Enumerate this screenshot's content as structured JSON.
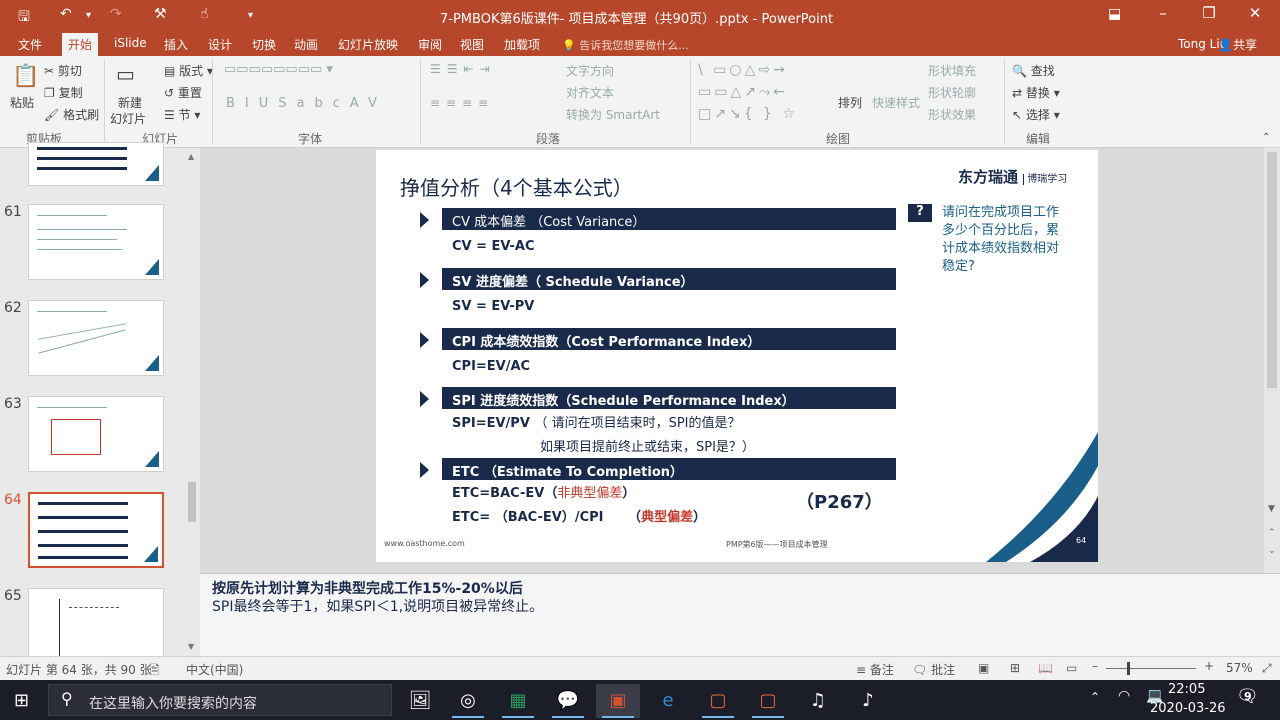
{
  "titlebar": {
    "doc_title": "7-PMBOK第6版课件- 项目成本管理（共90页）.pptx - PowerPoint",
    "undo_icon": "undo-icon",
    "save_icon": "save-icon"
  },
  "tabs": [
    "文件",
    "开始",
    "iSlide",
    "插入",
    "设计",
    "切换",
    "动画",
    "幻灯片放映",
    "审阅",
    "视图",
    "加载项"
  ],
  "tell_me": "告诉我您想要做什么...",
  "user_name": "Tong Liu",
  "share_label": "共享",
  "ribbon": {
    "clipboard": {
      "paste": "粘贴",
      "cut": "剪切",
      "copy": "复制",
      "format_painter": "格式刷",
      "label": "剪贴板"
    },
    "slides": {
      "new_slide": "新建",
      "new_slide2": "幻灯片",
      "layout": "版式",
      "reset": "重置",
      "section": "节",
      "label": "幻灯片"
    },
    "font": {
      "label": "字体"
    },
    "paragraph": {
      "text_dir": "文字方向",
      "align_text": "对齐文本",
      "smartart": "转换为 SmartArt",
      "label": "段落"
    },
    "drawing": {
      "arrange": "排列",
      "quick_styles": "快速样式",
      "fill": "形状填充",
      "outline": "形状轮廓",
      "effects": "形状效果",
      "label": "绘图"
    },
    "editing": {
      "find": "查找",
      "replace": "替换",
      "select": "选择",
      "label": "编辑"
    }
  },
  "thumbs": [
    {
      "num": "61"
    },
    {
      "num": "62"
    },
    {
      "num": "63"
    },
    {
      "num": "64"
    },
    {
      "num": "65"
    }
  ],
  "slide": {
    "title": "挣值分析（4个基本公式）",
    "logo": "东方瑞通",
    "logo_sub": "博瑞学习",
    "sections": [
      {
        "header": "CV 成本偏差 （Cost Variance）",
        "formula": "CV = EV-AC"
      },
      {
        "header": "SV 进度偏差（ Schedule Variance）",
        "formula": "SV = EV-PV"
      },
      {
        "header": "CPI 成本绩效指数（Cost Performance Index）",
        "formula": "CPI=EV/AC"
      },
      {
        "header": "SPI 进度绩效指数（Schedule Performance Index）",
        "formula": "SPI=EV/PV"
      },
      {
        "header": "ETC （Estimate To Completion）",
        "formula": "ETC=BAC-EV（"
      }
    ],
    "spi_note1": "（ 请问在项目结束时，SPI的值是？",
    "spi_note2": "如果项目提前终止或结束，SPI是？）",
    "etc_atypical": "非典型偏差",
    "etc_close": "）",
    "etc2": "ETC= （BAC-EV）/CPI",
    "etc2_note_open": "（",
    "etc2_typical": "典型偏差",
    "etc2_note_close": "）",
    "page_ref": "（P267）",
    "question": "请问在完成项目工作多少个百分比后，累计成本绩效指数相对稳定?",
    "footer_left": "www.oasthome.com",
    "footer_mid": "PMP第6版——项目成本管理",
    "page_num": "64",
    "accent_navy": "#1a2a4a",
    "accent_blue": "#1a5f8a"
  },
  "notes": {
    "line1": "按原先计划计算为非典型完成工作15%-20%以后",
    "line2": "SPI最终会等于1，如果SPI＜1,说明项目被异常终止。"
  },
  "status": {
    "slide_info": "幻灯片 第 64 张，共 90 张",
    "language": "中文(中国)",
    "notes_btn": "备注",
    "comments_btn": "批注",
    "zoom": "57%"
  },
  "taskbar": {
    "search_placeholder": "在这里输入你要搜索的内容",
    "time": "22:05",
    "date": "2020-03-26",
    "notif_count": "9"
  }
}
